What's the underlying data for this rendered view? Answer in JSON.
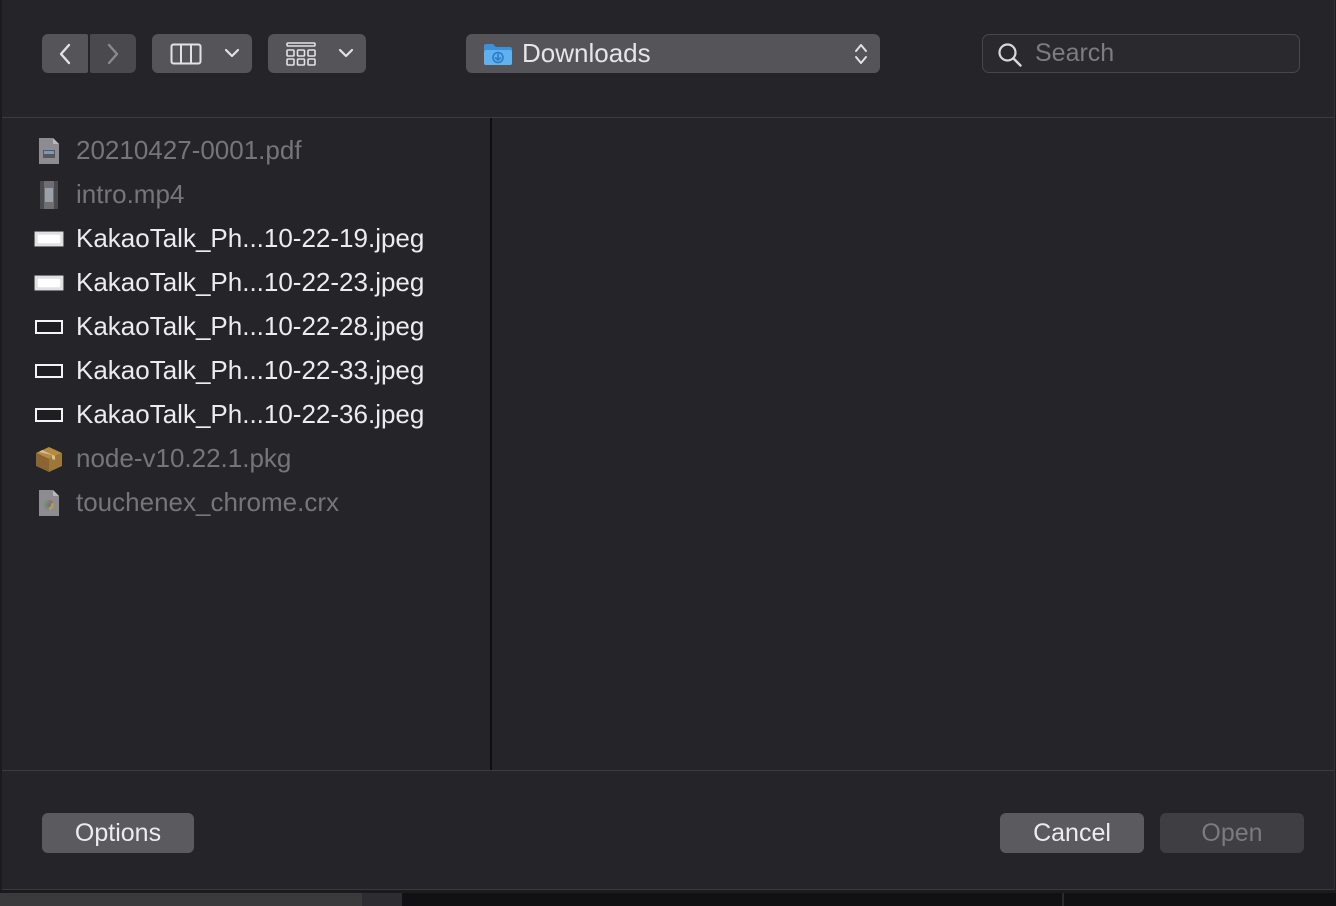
{
  "toolbar": {
    "location": "Downloads",
    "search_placeholder": "Search",
    "back_icon": "chevron-left-icon",
    "forward_icon": "chevron-right-icon",
    "column_view_icon": "columns-icon",
    "group_icon": "grid-icon"
  },
  "files": [
    {
      "name": "20210427-0001.pdf",
      "icon": "pdf-file-icon",
      "enabled": false
    },
    {
      "name": "intro.mp4",
      "icon": "video-file-icon",
      "enabled": false
    },
    {
      "name": "KakaoTalk_Ph...10-22-19.jpeg",
      "icon": "image-file-icon",
      "enabled": true
    },
    {
      "name": "KakaoTalk_Ph...10-22-23.jpeg",
      "icon": "image-file-icon",
      "enabled": true
    },
    {
      "name": "KakaoTalk_Ph...10-22-28.jpeg",
      "icon": "image-file-icon",
      "enabled": true
    },
    {
      "name": "KakaoTalk_Ph...10-22-33.jpeg",
      "icon": "image-file-icon",
      "enabled": true
    },
    {
      "name": "KakaoTalk_Ph...10-22-36.jpeg",
      "icon": "image-file-icon",
      "enabled": true
    },
    {
      "name": "node-v10.22.1.pkg",
      "icon": "package-icon",
      "enabled": false
    },
    {
      "name": "touchenex_chrome.crx",
      "icon": "chrome-extension-icon",
      "enabled": false
    }
  ],
  "footer": {
    "options_label": "Options",
    "cancel_label": "Cancel",
    "open_label": "Open"
  },
  "colors": {
    "background": "#252428",
    "button": "#5b5a5e",
    "text": "#ececee",
    "disabled_text": "#76757a",
    "folder_accent": "#4aa3e8"
  }
}
